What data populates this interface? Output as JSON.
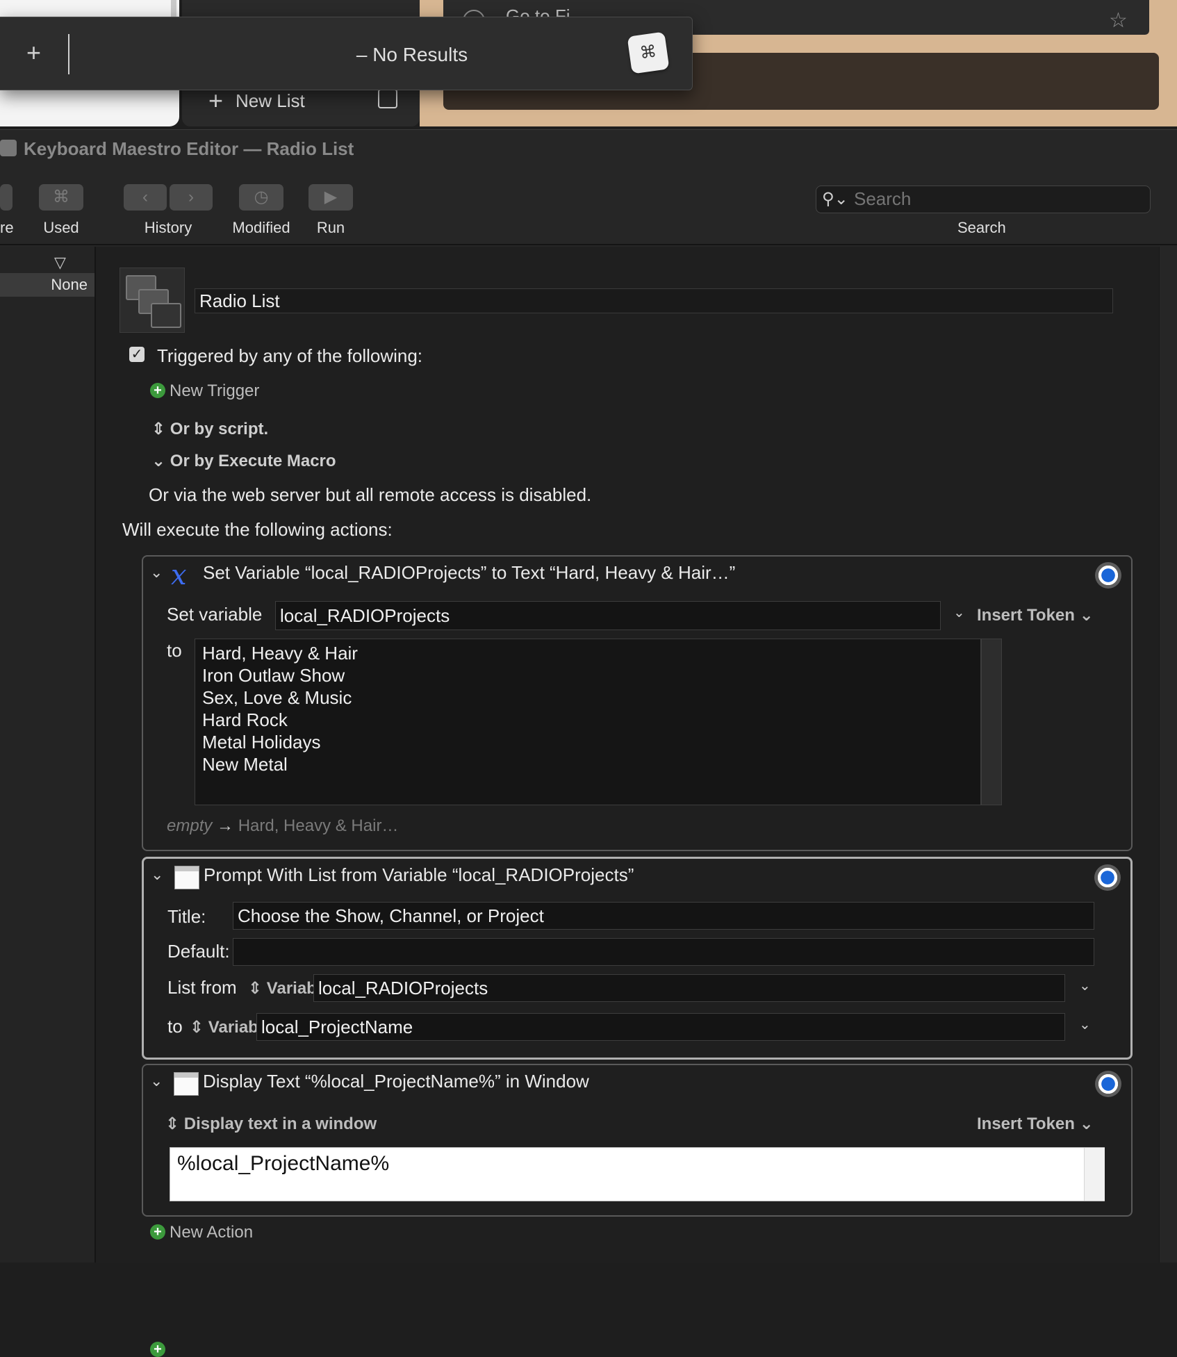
{
  "background": {
    "top_right_cut_text": "Go to Fi...",
    "new_list_label": "New List"
  },
  "hud": {
    "plus": "+",
    "status": "– No Results",
    "app_icon_glyph": "⌘"
  },
  "window": {
    "title": "Keyboard Maestro Editor — Radio List",
    "toolbar": {
      "partial_label": "re",
      "used_label": "Used",
      "history_label": "History",
      "modified_label": "Modified",
      "run_label": "Run",
      "search_placeholder": "Search",
      "search_label": "Search"
    },
    "left": {
      "filter_icon": "▽",
      "none_label": "None"
    }
  },
  "macro": {
    "name": "Radio List",
    "triggered_label": "Triggered by any of the following:",
    "new_trigger": "New Trigger",
    "or_script": "Or by script.",
    "or_execute": "Or by Execute Macro",
    "web_server": "Or via the web server but all remote access is disabled.",
    "will_execute": "Will execute the following actions:",
    "new_action": "New Action"
  },
  "actions": [
    {
      "title": "Set Variable “local_RADIOProjects” to Text “Hard, Heavy & Hair…”",
      "set_variable_label": "Set variable",
      "variable": "local_RADIOProjects",
      "insert_token": "Insert Token",
      "to_label": "to",
      "text": "Hard, Heavy & Hair\nIron Outlaw Show\nSex, Love & Music\nHard Rock\nMetal Holidays\nNew Metal",
      "empty_label": "empty",
      "empty_result": "Hard, Heavy & Hair…"
    },
    {
      "title": "Prompt With List from Variable “local_RADIOProjects”",
      "title_label": "Title:",
      "title_value": "Choose the Show, Channel, or Project",
      "default_label": "Default:",
      "default_value": "",
      "list_from_label": "List from",
      "variable_word": "Variable",
      "list_from_value": "local_RADIOProjects",
      "to_label": "to",
      "to_value": "local_ProjectName"
    },
    {
      "title": "Display Text “%local_ProjectName%” in Window",
      "mode_label": "Display text in a window",
      "insert_token": "Insert Token",
      "text": "%local_ProjectName%"
    }
  ],
  "colors": {
    "accent_blue": "#1a66d8",
    "green_add": "#3c9a3c",
    "tan_background": "#d7b692"
  }
}
